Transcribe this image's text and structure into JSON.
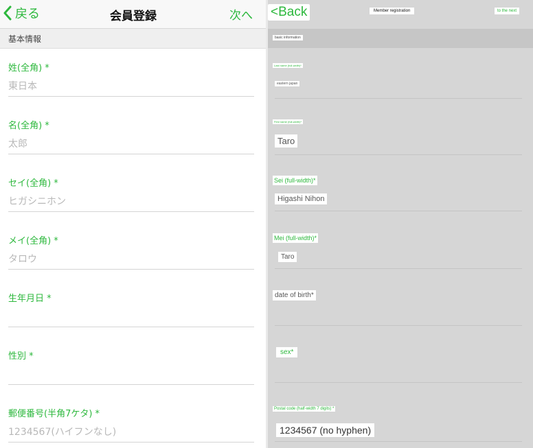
{
  "original": {
    "nav": {
      "back_label": "戻る",
      "title": "会員登録",
      "next_label": "次へ"
    },
    "section_header": "基本情報",
    "fields": [
      {
        "label": "姓(全角) *",
        "placeholder": "東日本"
      },
      {
        "label": "名(全角) *",
        "placeholder": "太郎"
      },
      {
        "label": "セイ(全角) *",
        "placeholder": "ヒガシニホン"
      },
      {
        "label": "メイ(全角) *",
        "placeholder": "タロウ"
      },
      {
        "label": "生年月日 *",
        "placeholder": ""
      },
      {
        "label": "性別 *",
        "placeholder": ""
      },
      {
        "label": "郵便番号(半角7ケタ) *",
        "placeholder": "1234567(ハイフンなし)"
      }
    ]
  },
  "translation": {
    "nav": {
      "back_label": "<Back",
      "title": "Member registration",
      "next_label": "to the next"
    },
    "section_header": "basic information",
    "fields": [
      {
        "label": "Last name (full-width)*",
        "value": "eastern japan"
      },
      {
        "label": "First name (full-width)*",
        "value": "Taro"
      },
      {
        "label": "Sei (full-width)*",
        "value": "Higashi Nihon"
      },
      {
        "label": "Mei (full-width)*",
        "value": "Taro"
      },
      {
        "label": "date of birth*",
        "value": ""
      },
      {
        "label": "sex*",
        "value": ""
      },
      {
        "label": "Postal code (half-width 7 digits) *",
        "value": "1234567 (no hyphen)"
      }
    ]
  },
  "colors": {
    "accent": "#2db83d",
    "translated_background": "#d6d6d6",
    "section_background": "#efefef"
  }
}
